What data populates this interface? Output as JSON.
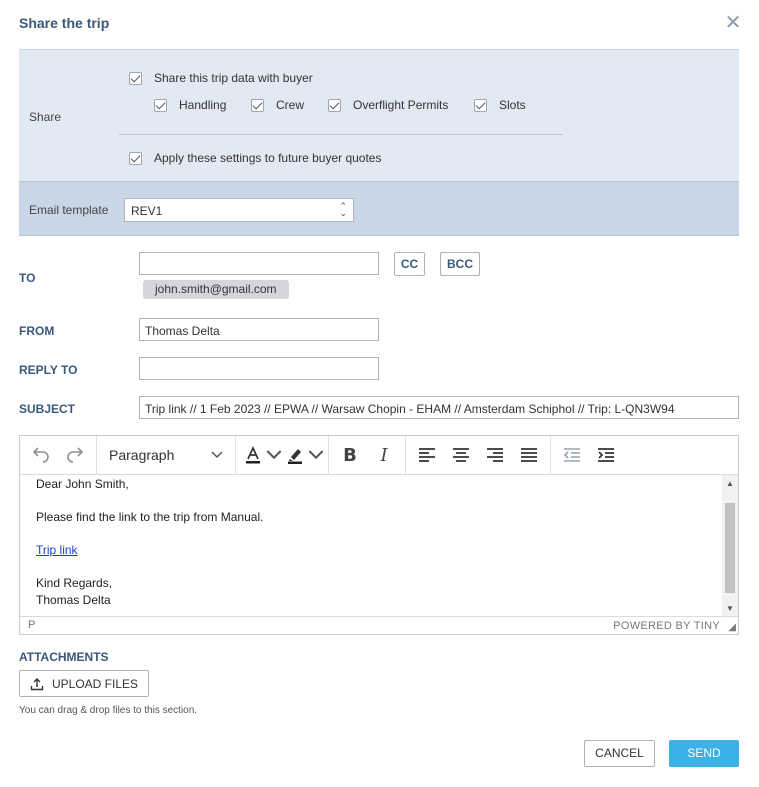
{
  "dialog": {
    "title": "Share the trip",
    "close_icon": "close-icon"
  },
  "share": {
    "label": "Share",
    "share_trip_data": "Share this trip data with buyer",
    "options": [
      "Handling",
      "Crew",
      "Overflight Permits",
      "Slots"
    ],
    "apply_future": "Apply these settings to future buyer quotes"
  },
  "email_template": {
    "label": "Email template",
    "selected": "REV1"
  },
  "to": {
    "label": "TO",
    "value": "",
    "cc_label": "CC",
    "bcc_label": "BCC",
    "recipient": "john.smith@gmail.com"
  },
  "from": {
    "label": "FROM",
    "value": "Thomas Delta"
  },
  "reply_to": {
    "label": "REPLY TO",
    "value": ""
  },
  "subject": {
    "label": "SUBJECT",
    "value": "Trip link // 1 Feb 2023 // EPWA // Warsaw Chopin - EHAM // Amsterdam Schiphol // Trip: L-QN3W94"
  },
  "editor": {
    "format_select": "Paragraph",
    "body": {
      "greeting": "Dear John Smith,",
      "line1": "Please find the link to the trip from Manual.",
      "link": "Trip link",
      "closing": "Kind Regards,",
      "signature": "Thomas Delta"
    },
    "status_path": "P",
    "powered_by": "POWERED BY TINY"
  },
  "attachments": {
    "label": "ATTACHMENTS",
    "upload_label": "UPLOAD FILES",
    "hint": "You can drag & drop files to this section."
  },
  "actions": {
    "cancel": "CANCEL",
    "send": "SEND"
  },
  "colors": {
    "accent": "#3cb1e8",
    "label": "#3a5878",
    "share_bg": "#e2e9f3",
    "template_bg": "#c9d6e6"
  }
}
